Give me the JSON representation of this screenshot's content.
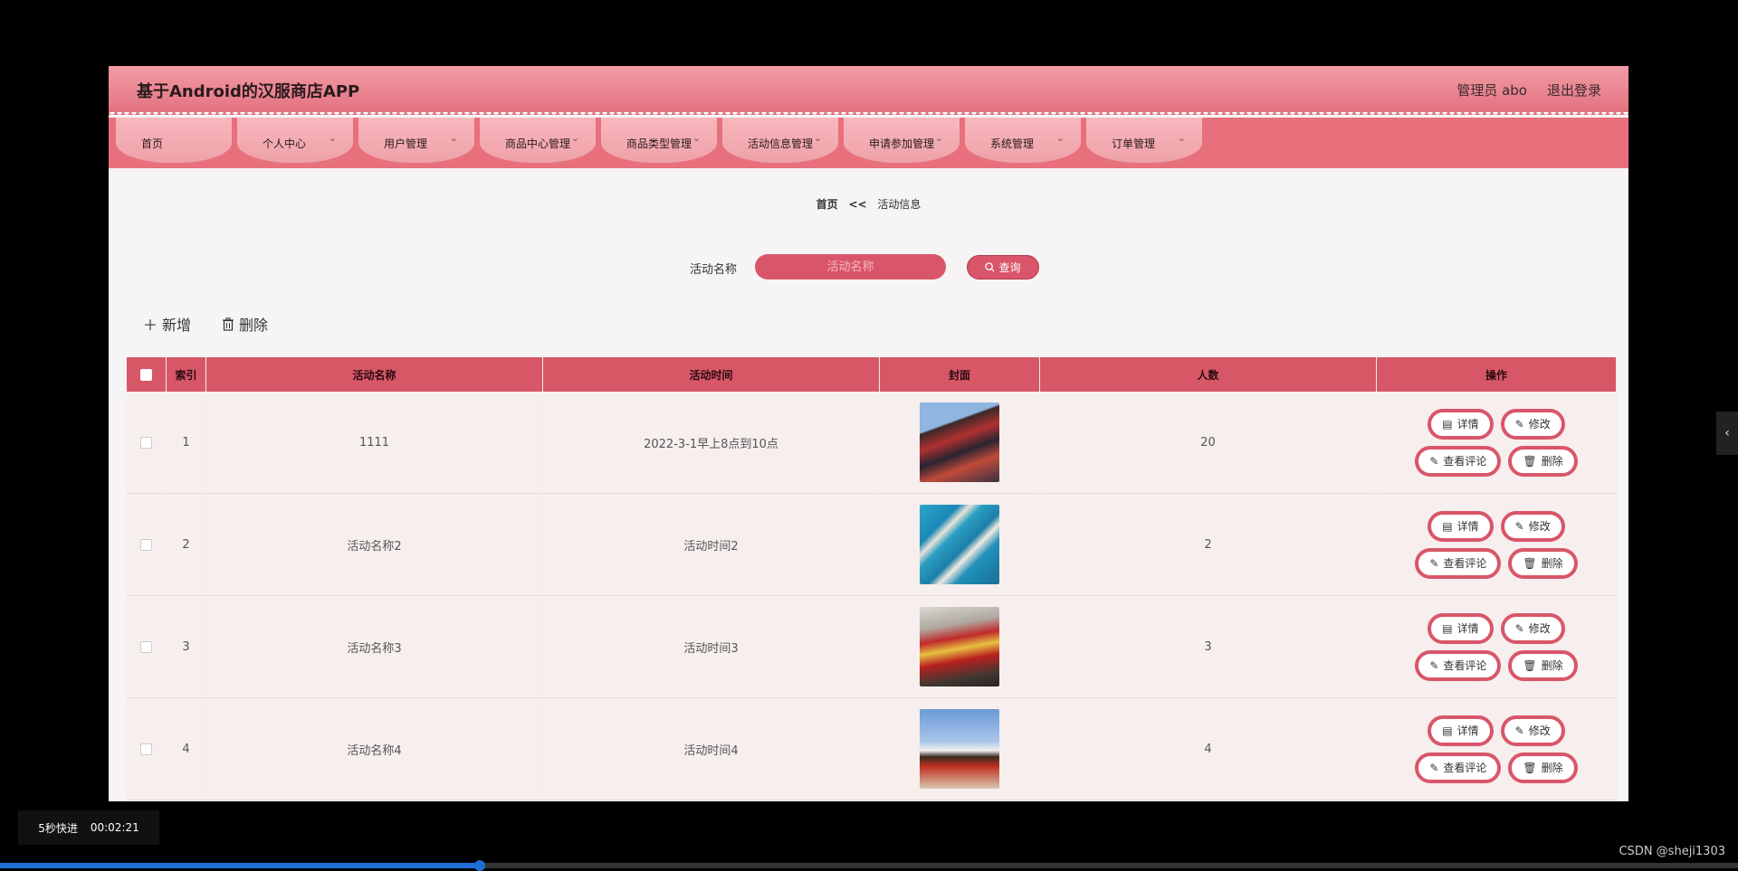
{
  "app": {
    "title": "基于Android的汉服商店APP",
    "user_label": "管理员 abo",
    "logout_label": "退出登录"
  },
  "nav": {
    "items": [
      {
        "label": "首页",
        "has_chevron": false
      },
      {
        "label": "个人中心",
        "has_chevron": true
      },
      {
        "label": "用户管理",
        "has_chevron": true
      },
      {
        "label": "商品中心管理",
        "has_chevron": true
      },
      {
        "label": "商品类型管理",
        "has_chevron": true
      },
      {
        "label": "活动信息管理",
        "has_chevron": true
      },
      {
        "label": "申请参加管理",
        "has_chevron": true
      },
      {
        "label": "系统管理",
        "has_chevron": true
      },
      {
        "label": "订单管理",
        "has_chevron": true
      }
    ]
  },
  "breadcrumb": {
    "home": "首页",
    "separator": "<<",
    "current": "活动信息"
  },
  "search": {
    "label": "活动名称",
    "placeholder": "活动名称",
    "button_label": "查询"
  },
  "toolbar": {
    "add_label": "新增",
    "delete_label": "删除"
  },
  "table": {
    "headers": [
      "索引",
      "活动名称",
      "活动时间",
      "封面",
      "人数",
      "操作"
    ],
    "rows": [
      {
        "index": "1",
        "name": "1111",
        "time": "2022-3-1早上8点到10点",
        "count": "20"
      },
      {
        "index": "2",
        "name": "活动名称2",
        "time": "活动时间2",
        "count": "2"
      },
      {
        "index": "3",
        "name": "活动名称3",
        "time": "活动时间3",
        "count": "3"
      },
      {
        "index": "4",
        "name": "活动名称4",
        "time": "活动时间4",
        "count": "4"
      }
    ],
    "row_actions": {
      "detail": "详情",
      "edit": "修改",
      "comments": "查看评论",
      "delete": "删除"
    }
  },
  "player": {
    "skip_label": "5秒快进",
    "timestamp": "00:02:21",
    "progress": 0.276
  },
  "watermark": "CSDN @sheji1303",
  "colors": {
    "accent": "#d9566a",
    "header_top": "#f29ca5",
    "nav_bg": "#e8707d"
  }
}
